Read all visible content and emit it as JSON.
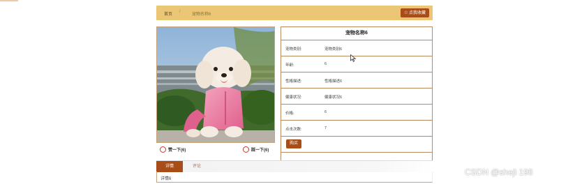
{
  "breadcrumb": {
    "home": "首页",
    "separator": "/",
    "current": "宠物名称6"
  },
  "favorite_button": {
    "icon": "star-icon",
    "label": "点我收藏"
  },
  "reactions": {
    "up_label": "赞一下(6)",
    "down_label": "踩一下(6)"
  },
  "info": {
    "title": "宠物名称6",
    "rows": [
      {
        "key": "宠物类别:",
        "value": "宠物类别6"
      },
      {
        "key": "年龄:",
        "value": "6"
      },
      {
        "key": "性格描述:",
        "value": "性格描述6"
      },
      {
        "key": "健康状况:",
        "value": "健康状况6"
      },
      {
        "key": "价格:",
        "value": "6"
      },
      {
        "key": "点击次数:",
        "value": "7"
      }
    ],
    "buy_label": "购买"
  },
  "tabs": [
    {
      "label": "详情"
    },
    {
      "label": "评论"
    }
  ],
  "tab_content": "详情6",
  "watermark": "CSDN @sheji 198",
  "colors": {
    "accent": "#a84d17",
    "bar": "#ebc775",
    "border": "#b88a5e"
  }
}
